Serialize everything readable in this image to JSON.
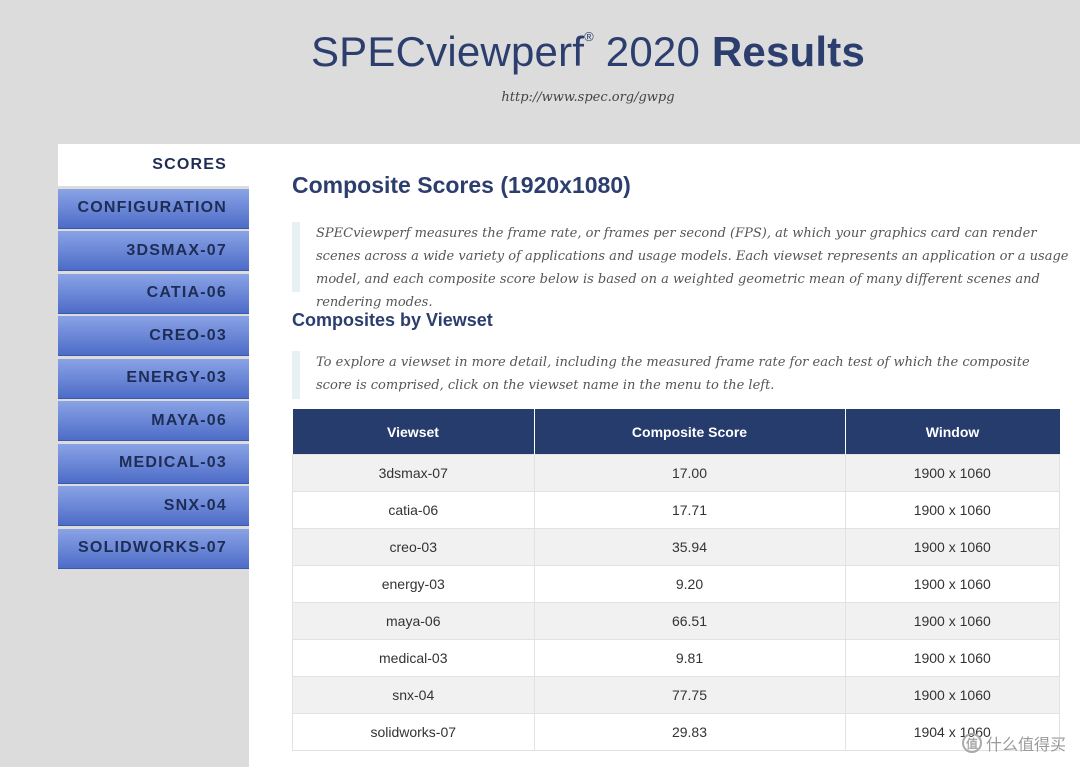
{
  "header": {
    "title_main": "SPECviewperf",
    "title_reg": "®",
    "title_year": "2020",
    "title_bold": "Results",
    "url": "http://www.spec.org/gwpg"
  },
  "sidebar": {
    "items": [
      {
        "label": "SCORES",
        "active": true
      },
      {
        "label": "CONFIGURATION"
      },
      {
        "label": "3DSMAX-07"
      },
      {
        "label": "CATIA-06"
      },
      {
        "label": "CREO-03"
      },
      {
        "label": "ENERGY-03"
      },
      {
        "label": "MAYA-06"
      },
      {
        "label": "MEDICAL-03"
      },
      {
        "label": "SNX-04"
      },
      {
        "label": "SOLIDWORKS-07"
      }
    ]
  },
  "main": {
    "heading": "Composite Scores (1920x1080)",
    "intro": "SPECviewperf measures the frame rate, or frames per second (FPS), at which your graphics card can render scenes across a wide variety of applications and usage models. Each viewset represents an application or a usage model, and each composite score below is based on a weighted geometric mean of many different scenes and rendering modes.",
    "subheading": "Composites by Viewset",
    "note": "To explore a viewset in more detail, including the measured frame rate for each test of which the composite score is comprised, click on the viewset name in the menu to the left.",
    "table": {
      "headers": [
        "Viewset",
        "Composite Score",
        "Window"
      ],
      "rows": [
        [
          "3dsmax-07",
          "17.00",
          "1900 x 1060"
        ],
        [
          "catia-06",
          "17.71",
          "1900 x 1060"
        ],
        [
          "creo-03",
          "35.94",
          "1900 x 1060"
        ],
        [
          "energy-03",
          "9.20",
          "1900 x 1060"
        ],
        [
          "maya-06",
          "66.51",
          "1900 x 1060"
        ],
        [
          "medical-03",
          "9.81",
          "1900 x 1060"
        ],
        [
          "snx-04",
          "77.75",
          "1900 x 1060"
        ],
        [
          "solidworks-07",
          "29.83",
          "1904 x 1060"
        ]
      ]
    }
  },
  "watermark": {
    "icon_char": "值",
    "text": "什么值得买"
  }
}
